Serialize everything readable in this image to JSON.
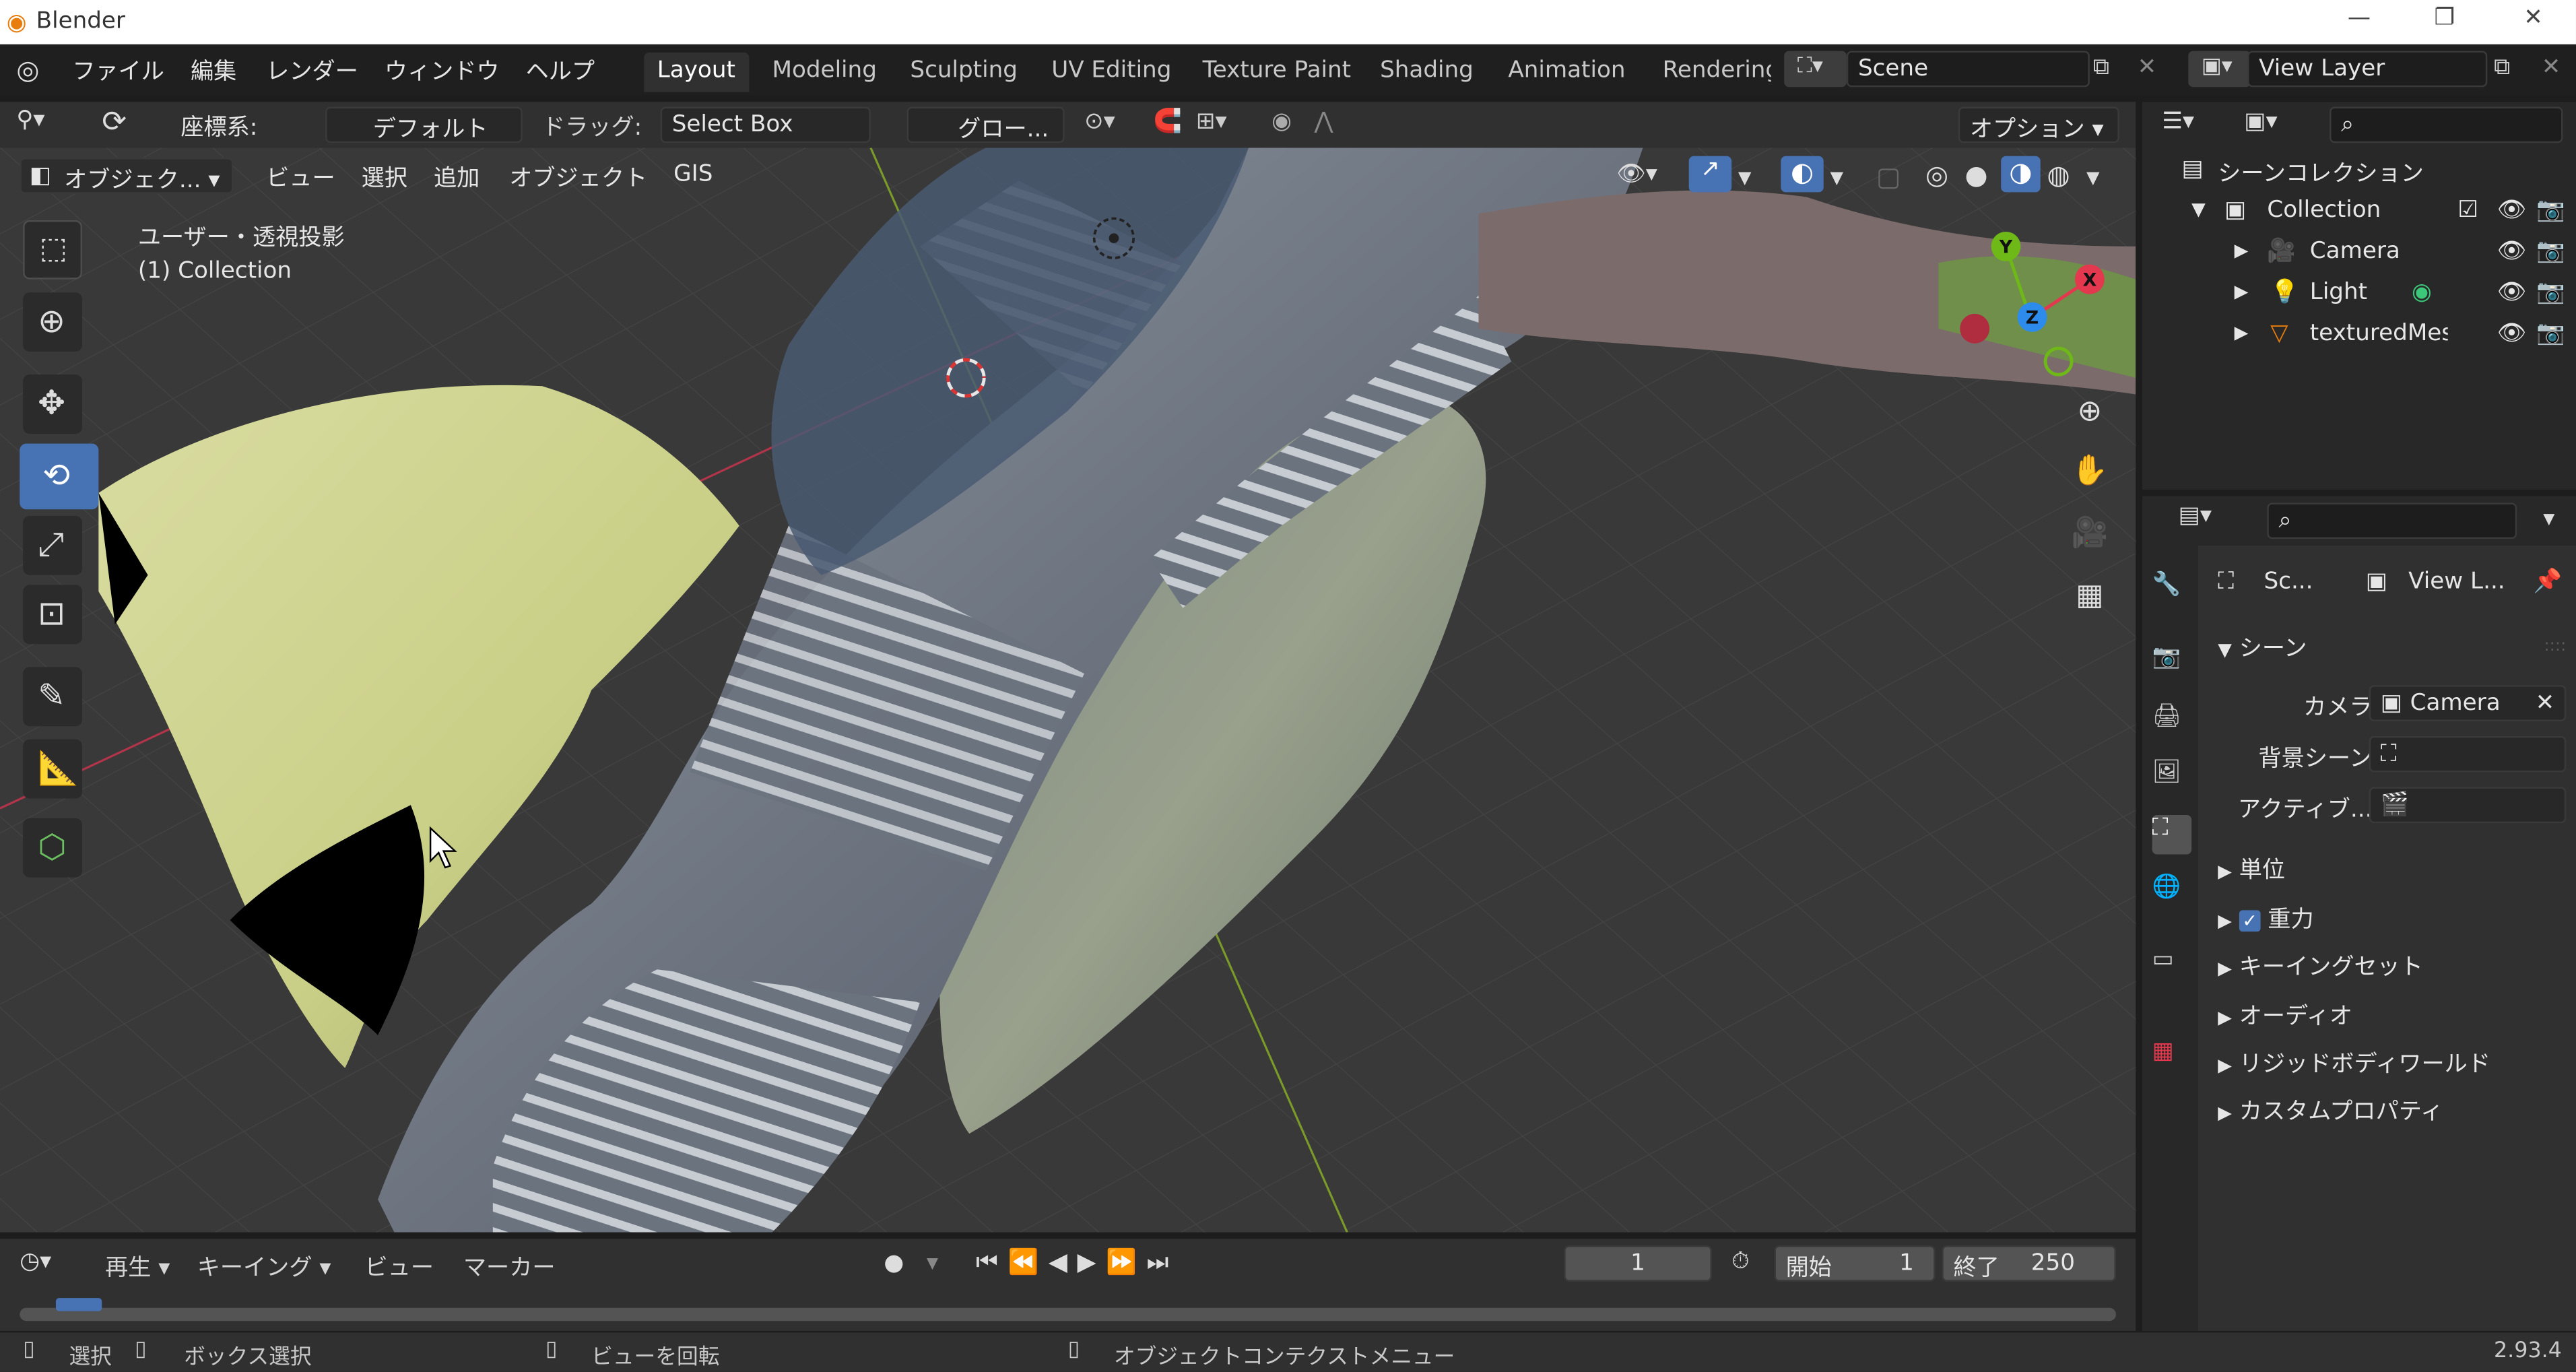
{
  "titlebar": {
    "app_title": "Blender",
    "minimize": "—",
    "restore": "❐",
    "close": "✕"
  },
  "menubar": {
    "items": [
      "ファイル",
      "編集",
      "レンダー",
      "ウィンドウ",
      "ヘルプ"
    ],
    "workspaces": [
      "Layout",
      "Modeling",
      "Sculpting",
      "UV Editing",
      "Texture Paint",
      "Shading",
      "Animation",
      "Rendering"
    ],
    "scene": "Scene",
    "view_layer": "View Layer"
  },
  "header3d": {
    "coord_label": "座標系:",
    "orientation": "デフォルト",
    "drag_label": "ドラッグ:",
    "drag_value": "Select Box",
    "pivot": "グロー...",
    "options": "オプション"
  },
  "viewport_header": {
    "mode": "オブジェク...",
    "menus": [
      "ビュー",
      "選択",
      "追加",
      "オブジェクト",
      "GIS"
    ]
  },
  "viewport": {
    "view_name": "ユーザー・透視投影",
    "collection": "(1) Collection"
  },
  "gizmo": {
    "x": "X",
    "y": "Y",
    "z": "Z"
  },
  "timeline": {
    "menus": [
      "再生",
      "キーイング",
      "ビュー",
      "マーカー"
    ],
    "current_frame": "1",
    "start_label": "開始",
    "start_value": "1",
    "end_label": "終了",
    "end_value": "250"
  },
  "outliner": {
    "root": "シーンコレクション",
    "collection": "Collection",
    "items": [
      "Camera",
      "Light",
      "texturedMesl"
    ]
  },
  "properties": {
    "breadcrumb_scene": "Sc...",
    "breadcrumb_layer": "View L...",
    "section": "シーン",
    "camera_label": "カメラ",
    "camera_value": "Camera",
    "bg_scene_label": "背景シーン",
    "active_label": "アクティブ...",
    "panels": [
      "単位",
      "重力",
      "キーイングセット",
      "オーディオ",
      "リジッドボディワールド",
      "カスタムプロパティ"
    ]
  },
  "statusbar": {
    "select": "選択",
    "box_select": "ボックス選択",
    "rotate_view": "ビューを回転",
    "context_menu": "オブジェクトコンテクストメニュー",
    "version": "2.93.4"
  },
  "colors": {
    "accent": "#4772b3",
    "x_axis": "#e3384e",
    "y_axis": "#6eb818",
    "z_axis": "#2d8ceb",
    "orange": "#e87d0d"
  }
}
